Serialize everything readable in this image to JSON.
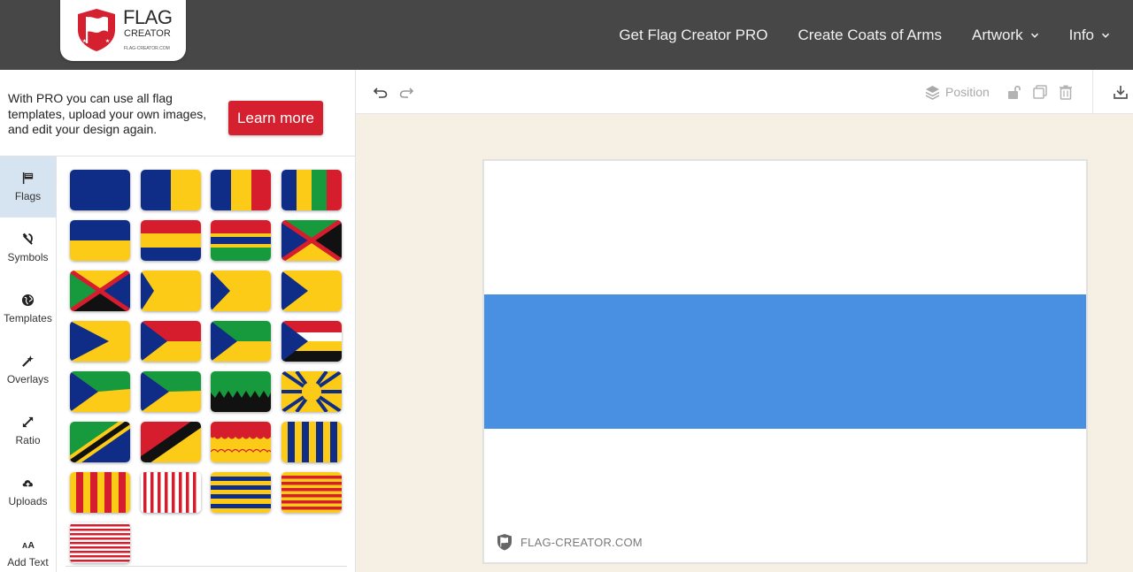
{
  "brand": {
    "line1": "FLAG",
    "line2": "CREATOR",
    "line3": "FLAG-CREATOR.COM"
  },
  "nav": [
    {
      "label": "Get Flag Creator PRO",
      "dropdown": false
    },
    {
      "label": "Create Coats of Arms",
      "dropdown": false
    },
    {
      "label": "Artwork",
      "dropdown": true
    },
    {
      "label": "Info",
      "dropdown": true
    }
  ],
  "pro_banner": {
    "text": "With PRO you can use all flag templates, upload your own images, and edit your design again.",
    "button": "Learn more"
  },
  "tools": [
    {
      "label": "Flags",
      "icon": "flag-icon",
      "active": true
    },
    {
      "label": "Symbols",
      "icon": "hammer-sickle-icon",
      "active": false
    },
    {
      "label": "Templates",
      "icon": "globe-icon",
      "active": false
    },
    {
      "label": "Overlays",
      "icon": "magic-wand-icon",
      "active": false
    },
    {
      "label": "Ratio",
      "icon": "resize-arrows-icon",
      "active": false
    },
    {
      "label": "Uploads",
      "icon": "cloud-upload-icon",
      "active": false
    },
    {
      "label": "Add Text",
      "icon": "text-size-icon",
      "active": false
    }
  ],
  "editor_toolbar": {
    "undo_icon": "undo-icon",
    "redo_icon": "redo-icon",
    "position_label": "Position",
    "position_icon": "layers-icon",
    "lock_icon": "unlock-icon",
    "duplicate_icon": "duplicate-icon",
    "delete_icon": "trash-icon",
    "download_icon": "download-icon"
  },
  "colors": {
    "header_bg": "#474747",
    "accent_red": "#d52030",
    "active_tool_bg": "#d6e4f1",
    "canvas_bg": "#f6efe3",
    "flag_blue": "#4a90e2",
    "flag_white": "#ffffff",
    "navy": "#0f2c87",
    "yellow": "#fccb17",
    "red": "#d51d2e",
    "green": "#169a3d"
  },
  "canvas": {
    "stripes": [
      "#ffffff",
      "#4a90e2",
      "#ffffff"
    ],
    "watermark": "FLAG-CREATOR.COM"
  },
  "flag_templates": [
    "solid-blue",
    "vertical-bicolor",
    "vertical-tricolor",
    "vertical-quad",
    "horizontal-bicolor",
    "horizontal-tricolor",
    "horizontal-tricolor-band",
    "saltire-triangles",
    "saltire-inverse",
    "chevron-small",
    "chevron-medium",
    "chevron-large",
    "triangle-hoist",
    "triangle-bicolor",
    "triangle-tricolor",
    "triangle-quad",
    "triangle-diagonal",
    "triangle-diagonal-alt",
    "serrated",
    "sunburst",
    "diagonal-band",
    "diagonal-band-black",
    "wavy-top",
    "pales-four",
    "pales-red-yellow",
    "pales-many",
    "bars-five",
    "bars-nine",
    "stripes-thirteen"
  ]
}
